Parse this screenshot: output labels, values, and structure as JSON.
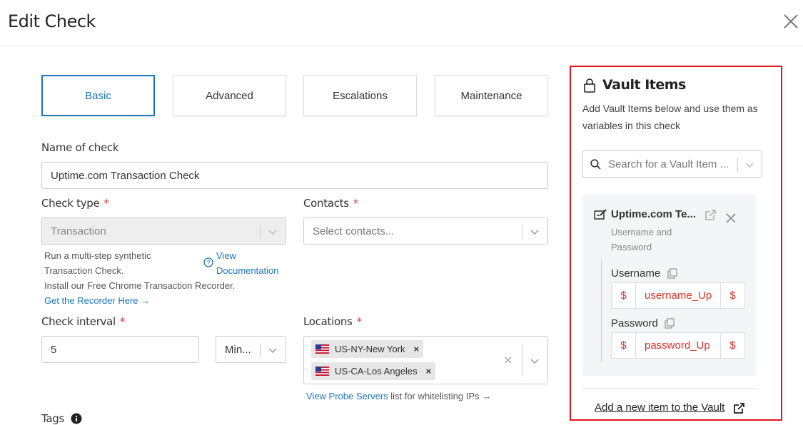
{
  "header": {
    "title": "Edit Check"
  },
  "tabs": [
    {
      "label": "Basic",
      "active": true
    },
    {
      "label": "Advanced",
      "active": false
    },
    {
      "label": "Escalations",
      "active": false
    },
    {
      "label": "Maintenance",
      "active": false
    }
  ],
  "form": {
    "name_label": "Name of check",
    "name_value": "Uptime.com Transaction Check",
    "check_type_label": "Check type",
    "check_type_value": "Transaction",
    "check_type_help_1": "Run a multi-step synthetic",
    "check_type_help_2": "Transaction Check.",
    "view_label": "View",
    "documentation_label": "Documentation",
    "recorder_text": "Install our Free Chrome Transaction Recorder.",
    "recorder_link": "Get the Recorder Here →",
    "contacts_label": "Contacts",
    "contacts_placeholder": "Select contacts...",
    "interval_label": "Check interval",
    "interval_value": "5",
    "interval_unit": "Min...",
    "locations_label": "Locations",
    "locations": [
      "US-NY-New York",
      "US-CA-Los Angeles"
    ],
    "probe_link": "View Probe Servers",
    "probe_text": " list for whitelisting IPs →",
    "tags_label": "Tags",
    "required_mark": "*"
  },
  "vault": {
    "title": "Vault Items",
    "description": "Add Vault Items below and use them as variables in this check",
    "search_placeholder": "Search for a Vault Item ...",
    "item": {
      "title": "Uptime.com Te...",
      "subtitle": "Username and Password",
      "fields": [
        {
          "label": "Username",
          "value": "username_Up",
          "dollar": "$"
        },
        {
          "label": "Password",
          "value": "password_Up",
          "dollar": "$"
        }
      ]
    },
    "add_link": "Add a new item to the Vault"
  },
  "colors": {
    "accent": "#1b76bc",
    "required": "#e03a3a",
    "highlight": "#e3131b",
    "variable": "#d9342b"
  }
}
